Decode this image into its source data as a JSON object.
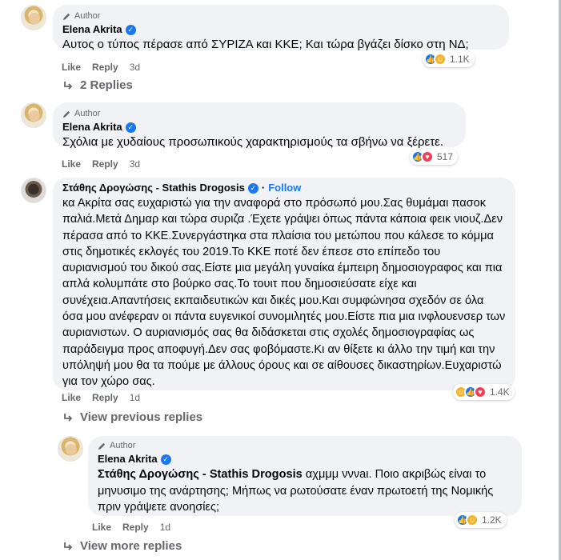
{
  "comments": [
    {
      "author_tag": "Author",
      "name": "Elena Akrita",
      "text": "Αυτος ο τύπος πέρασε από ΣΥΡΙΖΑ και ΚΚΕ; Και τώρα βγάζει δίσκο στη ΝΔ;",
      "like": "Like",
      "reply": "Reply",
      "time": "3d",
      "reaction_count": "1.1K",
      "reaction_icons": [
        "like",
        "haha"
      ]
    },
    {
      "author_tag": "Author",
      "name": "Elena Akrita",
      "text": "Σχόλια με χυδαίους προσωπικούς χαρακτηρισμούς τα σβήνω να ξέρετε.",
      "like": "Like",
      "reply": "Reply",
      "time": "3d",
      "reaction_count": "517",
      "reaction_icons": [
        "like",
        "love"
      ]
    },
    {
      "name": "Στάθης Δρογώσης - Stathis Drogosis",
      "follow_sep": "·",
      "follow": "Follow",
      "text": "κα Ακρίτα σας ευχαριστώ για την αναφορά στο πρόσωπό μου.Σας θυμάμαι πασοκ παλιά.Μετά Δημαρ και τώρα συριζα .Έχετε γράψει όπως πάντα κάποια φεικ νιουζ.Δεν πέρασα από το ΚΚΕ.Συνεργάστηκα στα πλαίσια του μετώπου που κάλεσε το κόμμα στις δημοτικές εκλογές του 2019.Το ΚΚΕ ποτέ δεν έπεσε στο επίπεδο του αυριανισμού του δικού σας.Είστε μια μεγάλη γυναίκα έμπειρη δημοσιογραφος και πια απλά κολυμπάτε στο βούρκο σας.Το τουιτ που δημοσιεύσατε είχε και συνέχεια.Απαντήσεις εκπαιδευτικών και δικές μου.Και συμφώνησα σχεδόν σε όλα όσα μου ανέφεραν οι πάντα ευγενικοί συνομιλητές μου.Είστε πια μια ινφλουενσερ των αυριανιστων. Ο αυριανισμός σας θα διδάσκεται στις σχολές δημοσιογραφίας ως παράδειγμα προς αποφυγή.Δεν σας φοβόμαστε.Κι αν θίξετε κι άλλο την τιμή και την υπόληψή μου θα τα πούμε με άλλους όρους και σε αίθουσες δικαστηρίων.Ευχαριστώ για τον χώρο σας.",
      "like": "Like",
      "reply": "Reply",
      "time": "1d",
      "reaction_count": "1.4K",
      "reaction_icons": [
        "haha",
        "like",
        "love"
      ]
    },
    {
      "author_tag": "Author",
      "name": "Elena Akrita",
      "tag": "Στάθης Δρογώσης - Stathis Drogosis",
      "text": " αχμμμ νννaι. Ποιο ακριβώς είναι το μηνυσιμο της ανάρτησης; Μήπως να ρωτούσατε έναν πρωτοετή της Νομικής πριν γράψετε ανοησίες;",
      "like": "Like",
      "reply": "Reply",
      "time": "1d",
      "reaction_count": "1.2K",
      "reaction_icons": [
        "like",
        "haha"
      ]
    }
  ],
  "links": {
    "two_replies": "2 Replies",
    "view_previous": "View previous replies",
    "view_more": "View more replies"
  },
  "colors": {
    "bubble": "#f0f2f5",
    "meta": "#65676b",
    "accent": "#1877f2"
  }
}
